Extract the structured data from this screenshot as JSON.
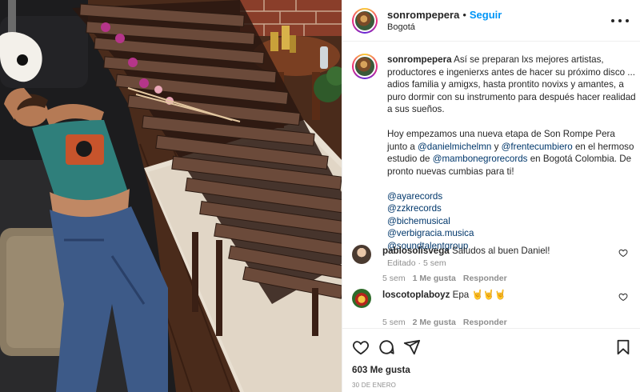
{
  "post": {
    "username": "sonrompepera",
    "follow_label": "Seguir",
    "separator": "•",
    "location": "Bogotá",
    "photo_alt": "photo",
    "caption": {
      "username": "sonrompepera",
      "paragraph1": "Así se preparan lxs mejores artistas, productores e ingenierxs antes de hacer su próximo disco ... adios familia y amigxs, hasta prontito novixs y amantes, a puro dormir con su instrumento para después hacer realidad a sus sueños.",
      "p2_part1": "Hoy empezamos una nueva etapa de Son Rompe Pera junto a ",
      "p2_mention1": "@danielmichelmn",
      "p2_part2": " y ",
      "p2_mention2": "@frentecumbiero",
      "p2_part3": " en el hermoso estudio de ",
      "p2_mention3": "@mambonegrorecords",
      "p2_part4": " en Bogotá Colombia. De pronto nuevas cumbias para ti!",
      "mentions": [
        "@ayarecords",
        "@zzkrecords",
        "@bichemusical",
        "@verbigracia.musica",
        "@soundtalentgroup"
      ],
      "edited": "Editado",
      "edited_sep": "·",
      "time": "5 sem"
    },
    "comments": [
      {
        "username": "pablosolisvega",
        "text": "Saludos al buen Daniel!",
        "time": "5 sem",
        "likes": "1 Me gusta",
        "reply": "Responder"
      },
      {
        "username": "loscotoplaboyz",
        "text": "Epa 🤘🤘🤘",
        "time": "5 sem",
        "likes": "2 Me gusta",
        "reply": "Responder"
      }
    ],
    "likes_count": "603 Me gusta",
    "date": "30 DE ENERO"
  },
  "icons": {
    "like": "heart-icon",
    "comment": "comment-icon",
    "share": "paper-plane-icon",
    "save": "bookmark-icon",
    "more": "ellipsis-icon"
  },
  "colors": {
    "link": "#00376b",
    "follow": "#0095f6",
    "secondary_text": "#8e8e8e",
    "border": "#efefef"
  }
}
